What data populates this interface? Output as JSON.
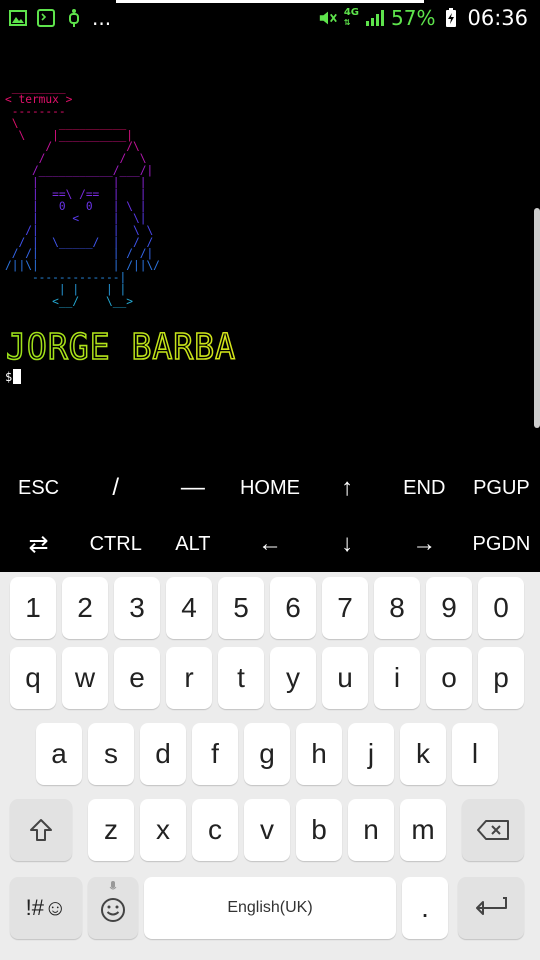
{
  "status_bar": {
    "notification_icons": [
      "gallery-icon",
      "terminal-icon",
      "usb-icon"
    ],
    "overflow": "...",
    "network_type": "4G",
    "battery_percent": "57%",
    "time": "06:36",
    "colors": {
      "indicator": "#5ee34c"
    }
  },
  "terminal": {
    "ascii_lines": [
      " ________",
      "< termux >",
      " --------",
      " \\      __________",
      "  \\    |__________|",
      "      /           /\\",
      "     /           /  \\",
      "    /___________/___/|",
      "    |           |   |",
      "    |  ==\\ /==  |   |",
      "    |   0   0   | \\ |",
      "    |     <     |  \\|",
      "   /|           |  \\ \\",
      "  / |  \\_____/  |  / /",
      " / /|           | / /|",
      "/||\\|           | /||\\/",
      "    -------------|",
      "        | |    | |",
      "       <__/    \\__>"
    ],
    "line_colors": [
      "#e0106a",
      "#e0106a",
      "#e0106a",
      "#e0106a",
      "#d6107f",
      "#c8139a",
      "#b418b2",
      "#a01ec6",
      "#8a24d4",
      "#7a2be0",
      "#6a33e8",
      "#5a3cee",
      "#4c48f0",
      "#4056ef",
      "#3566ea",
      "#2d77e4",
      "#2888de",
      "#2698d8",
      "#24a8d2"
    ],
    "banner_text": "JORGE BARBA",
    "prompt": "$"
  },
  "extra_keys": {
    "row1": [
      "ESC",
      "/",
      "—",
      "HOME",
      "↑",
      "END",
      "PGUP"
    ],
    "row2": [
      "⇄",
      "CTRL",
      "ALT",
      "←",
      "↓",
      "→",
      "PGDN"
    ]
  },
  "keyboard": {
    "numbers": [
      "1",
      "2",
      "3",
      "4",
      "5",
      "6",
      "7",
      "8",
      "9",
      "0"
    ],
    "row_q": [
      "q",
      "w",
      "e",
      "r",
      "t",
      "y",
      "u",
      "i",
      "o",
      "p"
    ],
    "row_a": [
      "a",
      "s",
      "d",
      "f",
      "g",
      "h",
      "j",
      "k",
      "l"
    ],
    "row_z": [
      "z",
      "x",
      "c",
      "v",
      "b",
      "n",
      "m"
    ],
    "symbols_key": "!#☺",
    "space_label": "English(UK)",
    "period": "."
  }
}
